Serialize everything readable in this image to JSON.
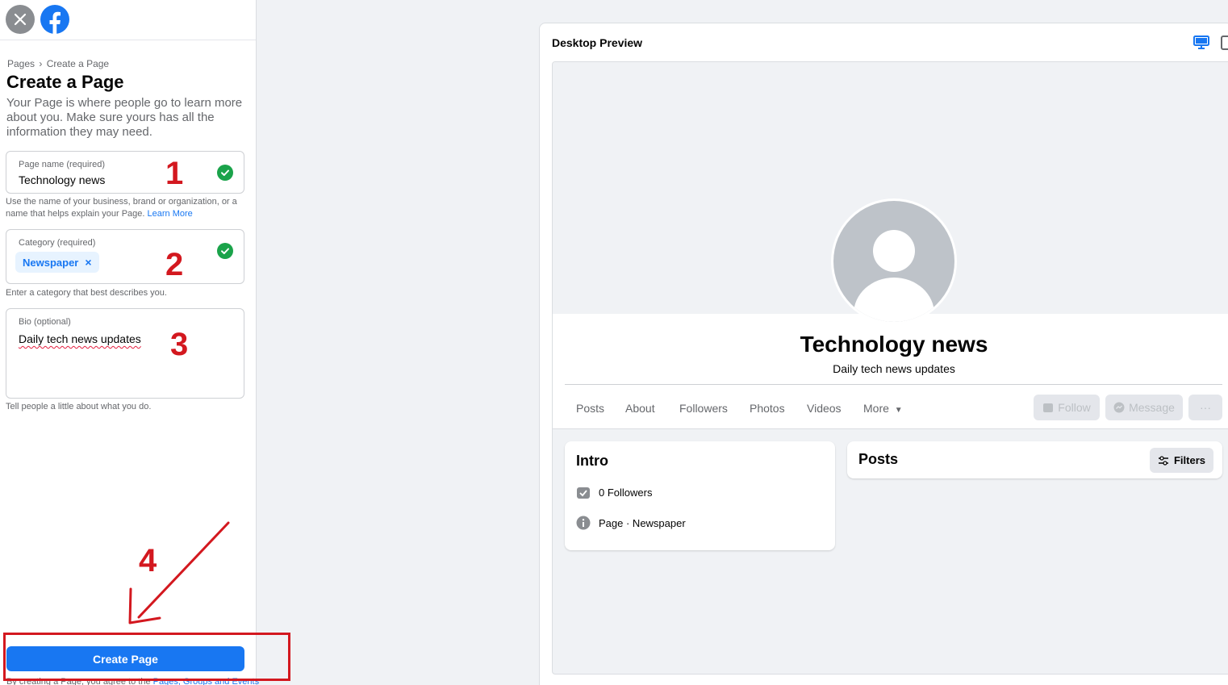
{
  "left": {
    "breadcrumb": [
      "Pages",
      "›",
      "Create a Page"
    ],
    "title": "Create a Page",
    "description": "Your Page is where people go to learn more about you. Make sure yours has all the information they may need.",
    "page_name": {
      "label": "Page name (required)",
      "value": "Technology news"
    },
    "page_name_hint": "Use the name of your business, brand or organization, or a name that helps explain your Page.",
    "learn_more": "Learn More",
    "category": {
      "label": "Category (required)",
      "chip": "Newspaper",
      "chip_remove": "×"
    },
    "category_hint": "Enter a category that best describes you.",
    "bio": {
      "label": "Bio (optional)",
      "value": "Daily tech news updates"
    },
    "bio_hint": "Tell people a little about what you do.",
    "create_button": "Create Page",
    "terms": "By creating a Page, you agree to the",
    "terms_link": "Pages, Groups and Events"
  },
  "annotations": {
    "n1": "1",
    "n2": "2",
    "n3": "3",
    "n4": "4",
    "color": "#d3181f"
  },
  "preview": {
    "header": "Desktop Preview",
    "page_name": "Technology news",
    "page_bio": "Daily tech news updates",
    "tabs": [
      "Posts",
      "About",
      "Followers",
      "Photos",
      "Videos",
      "More"
    ],
    "follow": "Follow",
    "message": "Message",
    "more_dots": "···",
    "intro_title": "Intro",
    "followers": "0 Followers",
    "page_type_prefix": "Page",
    "page_type": " · Newspaper",
    "posts_title": "Posts",
    "filters": "Filters"
  },
  "colors": {
    "brand": "#1877f2",
    "check": "#1aa34a"
  }
}
